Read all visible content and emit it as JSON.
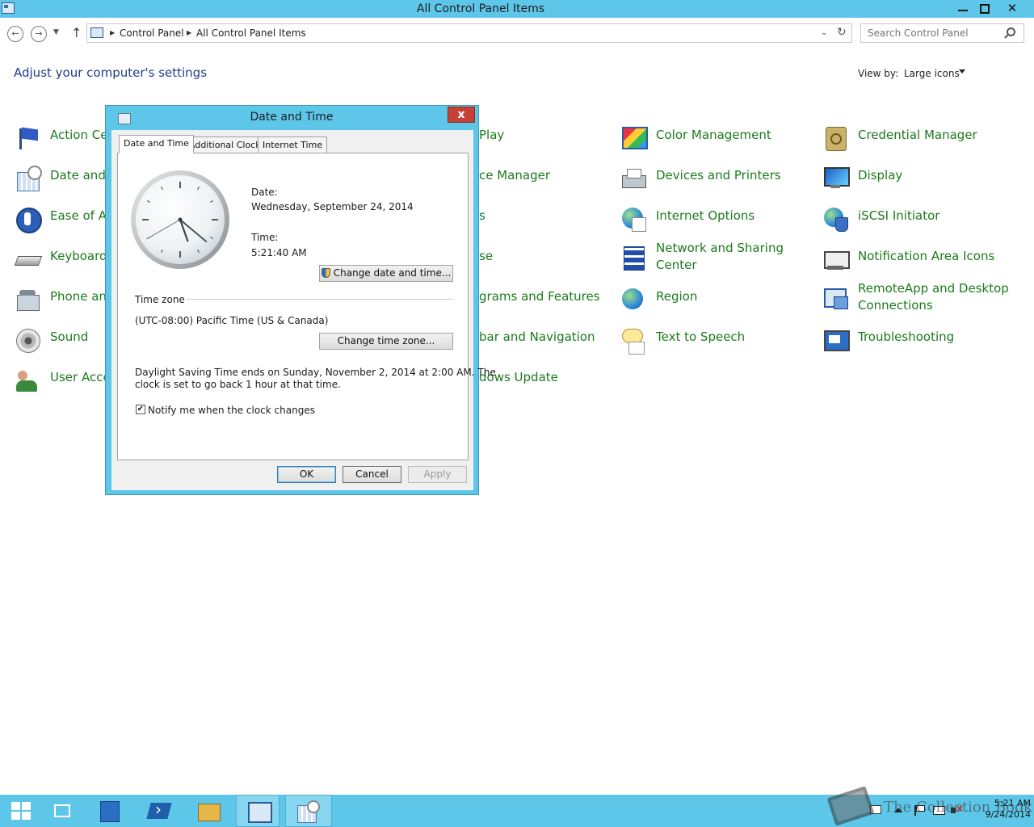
{
  "window": {
    "title": "All Control Panel Items"
  },
  "address_bar": {
    "breadcrumbs": [
      "Control Panel",
      "All Control Panel Items"
    ],
    "search_placeholder": "Search Control Panel"
  },
  "page": {
    "heading": "Adjust your computer's settings",
    "view_by_label": "View by:",
    "view_by_value": "Large icons"
  },
  "items": {
    "col1": [
      {
        "label": "Action Ce",
        "icon": "flag-icon"
      },
      {
        "label": "Date and",
        "icon": "calendar-clock-icon"
      },
      {
        "label": "Ease of Ac",
        "icon": "ease-of-access-icon"
      },
      {
        "label": "Keyboard",
        "icon": "keyboard-icon"
      },
      {
        "label": "Phone and",
        "icon": "phone-icon"
      },
      {
        "label": "Sound",
        "icon": "speaker-icon"
      },
      {
        "label": "User Acco",
        "icon": "users-icon"
      }
    ],
    "col2": [
      {
        "label": "Play"
      },
      {
        "label": "ce Manager"
      },
      {
        "label": "s"
      },
      {
        "label": "se"
      },
      {
        "label": "grams and Features"
      },
      {
        "label": "bar and Navigation"
      },
      {
        "label": "dows Update"
      }
    ],
    "col3": [
      {
        "label": "Color Management",
        "icon": "color-management-icon"
      },
      {
        "label": "Devices and Printers",
        "icon": "printer-icon"
      },
      {
        "label": "Internet Options",
        "icon": "globe-icon"
      },
      {
        "label": "Network and Sharing Center",
        "icon": "network-icon"
      },
      {
        "label": "Region",
        "icon": "region-globe-icon"
      },
      {
        "label": "Text to Speech",
        "icon": "speech-icon"
      }
    ],
    "col4": [
      {
        "label": "Credential Manager",
        "icon": "vault-icon"
      },
      {
        "label": "Display",
        "icon": "monitor-icon"
      },
      {
        "label": "iSCSI Initiator",
        "icon": "iscsi-icon"
      },
      {
        "label": "Notification Area Icons",
        "icon": "notification-area-icon"
      },
      {
        "label": "RemoteApp and Desktop Connections",
        "icon": "remoteapp-icon"
      },
      {
        "label": "Troubleshooting",
        "icon": "troubleshooting-icon"
      }
    ]
  },
  "dialog": {
    "title": "Date and Time",
    "close_label": "x",
    "tabs": [
      "Date and Time",
      "Additional Clocks",
      "Internet Time"
    ],
    "date_label": "Date:",
    "date_value": "Wednesday, September 24, 2014",
    "time_label": "Time:",
    "time_value": "5:21:40 AM",
    "change_datetime_label": "Change date and time...",
    "timezone_heading": "Time zone",
    "timezone_value": "(UTC-08:00) Pacific Time (US & Canada)",
    "change_timezone_label": "Change time zone...",
    "dst_line1": "Daylight Saving Time ends on Sunday, November 2, 2014 at 2:00 AM. The",
    "dst_line2": "clock is set to go back 1 hour at that time.",
    "notify_label": "Notify me when the clock changes",
    "notify_checked": true,
    "ok_label": "OK",
    "cancel_label": "Cancel",
    "apply_label": "Apply",
    "clock": {
      "hours": 5,
      "minutes": 21,
      "seconds": 40
    }
  },
  "taskbar": {
    "clock_time": "5:21 AM",
    "clock_date": "9/24/2014"
  },
  "watermark": {
    "text": "The Collection Book"
  },
  "colors": {
    "accent": "#5ec6e8",
    "link_green": "#1b7a1b",
    "heading_blue": "#1e3d8c",
    "close_red": "#c74236"
  }
}
